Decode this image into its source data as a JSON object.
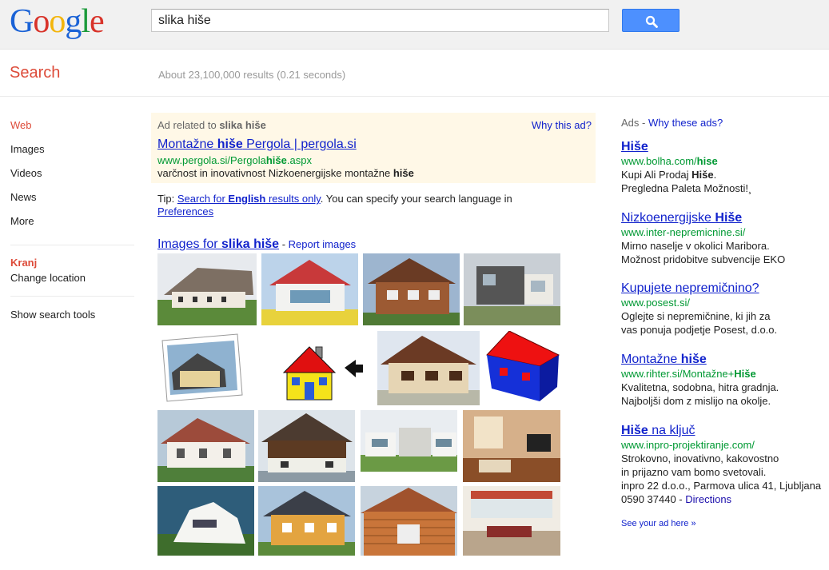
{
  "header": {
    "logo": [
      "G",
      "o",
      "o",
      "g",
      "l",
      "e"
    ],
    "search_value": "slika hiše",
    "search_button_icon": "magnifier-icon"
  },
  "subbar": {
    "title": "Search",
    "stats": "About 23,100,000 results (0.21 seconds)"
  },
  "leftnav": {
    "items": [
      {
        "label": "Web",
        "active": true
      },
      {
        "label": "Images"
      },
      {
        "label": "Videos"
      },
      {
        "label": "News"
      },
      {
        "label": "More"
      }
    ],
    "location_name": "Kranj",
    "change_location": "Change location",
    "tools": "Show search tools"
  },
  "top_ad": {
    "label_prefix": "Ad related to ",
    "label_query": "slika hiše",
    "why": "Why this ad?",
    "title_a": "Montažne ",
    "title_b": "hiše",
    "title_c": " Pergola | pergola.si",
    "url_a": "www.pergola.si/Pergola",
    "url_b": "hiše",
    "url_c": ".aspx",
    "desc_a": "varčnost in inovativnost Nizkoenergijske montažne ",
    "desc_b": "hiše"
  },
  "tip": {
    "prefix": "Tip: ",
    "link_a": "Search for ",
    "link_b": "English",
    "link_c": " results only",
    "middle": ". You can specify your search language in",
    "link2": "Preferences"
  },
  "images": {
    "head_a": "Images for ",
    "head_b": "slika hiše",
    "dash": " - ",
    "report": "Report images"
  },
  "right_ads": {
    "head": "Ads - ",
    "why": "Why these ads?",
    "ads": [
      {
        "title_a": "Hiše",
        "title_b": "",
        "url_a": "www.bolha.com/",
        "url_b": "hise",
        "l1a": "Kupi Ali Prodaj ",
        "l1b": "Hiše",
        "l1c": ".",
        "l2": "Pregledna Paleta Možnosti!¸"
      },
      {
        "title_a": "Nizkoenergijske ",
        "title_b": "Hiše",
        "url_a": "www.inter-nepremicnine.si/",
        "url_b": "",
        "l1a": "Mirno naselje v okolici Maribora.",
        "l1b": "",
        "l1c": "",
        "l2": "Možnost pridobitve subvencije EKO"
      },
      {
        "title_a": "Kupujete nepremičnino?",
        "title_b": "",
        "url_a": "www.posest.si/",
        "url_b": "",
        "l1a": "Oglejte si nepremičnine, ki jih za",
        "l1b": "",
        "l1c": "",
        "l2": "vas ponuja podjetje Posest, d.o.o."
      },
      {
        "title_a": "Montažne ",
        "title_b": "hiše",
        "url_a": "www.rihter.si/Montažne+",
        "url_b": "Hiše",
        "l1a": "Kvalitetna, sodobna, hitra gradnja.",
        "l1b": "",
        "l1c": "",
        "l2": "Najboljši dom z mislijo na okolje."
      },
      {
        "title_a": "Hiše",
        "title_b": " na ključ",
        "url_a": "www.inpro-projektiranje.com/",
        "url_b": "",
        "l1a": "Strokovno, inovativno, kakovostno",
        "l1b": "",
        "l1c": "",
        "l2": "in prijazno vam bomo svetovali.",
        "l3": "inpro 22 d.o.o., Parmova ulica 41, Ljubljana",
        "l4a": "0590 37440",
        "l4b": " - ",
        "l4c": "Directions"
      }
    ],
    "see_ad": "See your ad here »"
  },
  "colors": {
    "brand_red": "#dd4b39",
    "link_blue": "#1122cc",
    "url_green": "#009933",
    "ad_bg": "#fff8e7",
    "search_btn": "#4d90fe"
  }
}
